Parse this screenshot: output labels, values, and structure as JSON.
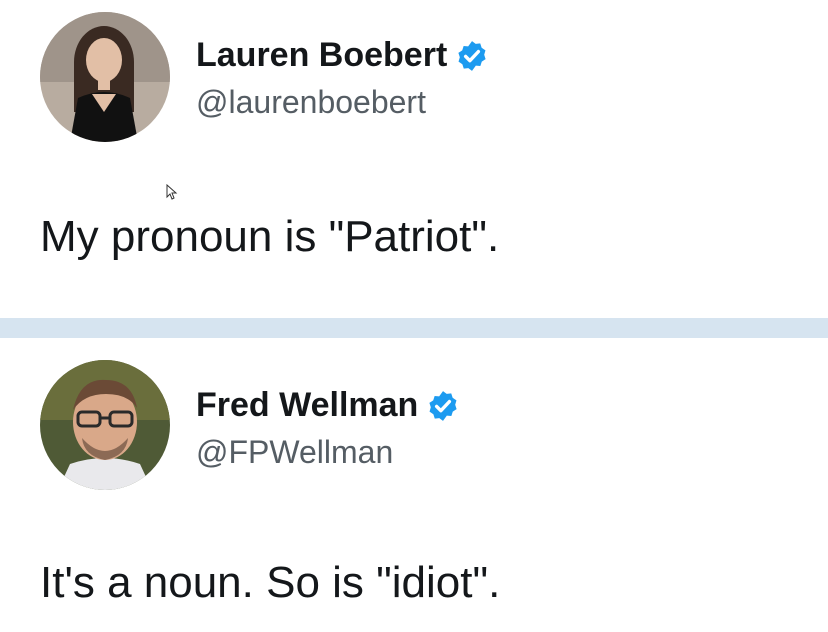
{
  "tweets": [
    {
      "display_name": "Lauren Boebert",
      "handle": "@laurenboebert",
      "text": "My pronoun is \"Patriot\".",
      "verified": true,
      "avatar": "profile-photo-icon"
    },
    {
      "display_name": "Fred Wellman",
      "handle": "@FPWellman",
      "text": "It's a noun. So is \"idiot\".",
      "verified": true,
      "avatar": "profile-photo-icon"
    }
  ],
  "colors": {
    "verified_badge": "#1d9bf0",
    "divider": "#d6e4f0",
    "text": "#14171a",
    "handle": "#555d64"
  },
  "icons": {
    "verified": "verified-badge-icon",
    "cursor": "mouse-cursor-icon"
  }
}
